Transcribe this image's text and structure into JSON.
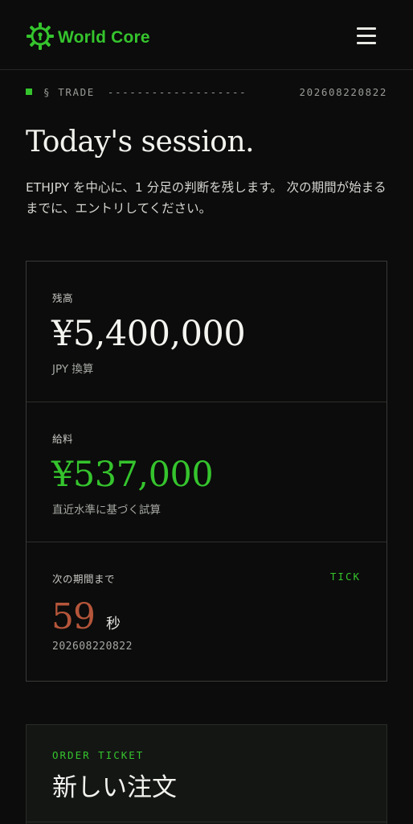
{
  "header": {
    "brand_name": "World Core",
    "logo_icon": "gear-lock-icon",
    "menu_icon": "hamburger-menu-icon",
    "accent_color": "#35c42d"
  },
  "section": {
    "label": "§ TRADE",
    "dashes": "-------------------",
    "timestamp": "202608220822"
  },
  "hero": {
    "title": "Today's session.",
    "intro": "ETHJPY を中心に、1 分足の判断を残します。 次の期間が始まるまでに、エントリしてください。"
  },
  "stats": {
    "balance": {
      "label": "残高",
      "value": "¥5,400,000",
      "sub": "JPY 換算"
    },
    "salary": {
      "label": "給料",
      "value": "¥537,000",
      "sub": "直近水準に基づく試算"
    },
    "countdown": {
      "label": "次の期間まで",
      "tag": "TICK",
      "seconds": "59",
      "unit": "秒",
      "timestamp": "202608220822",
      "seconds_color": "#b5553a"
    }
  },
  "order_ticket": {
    "eyebrow": "ORDER TICKET",
    "title": "新しい注文"
  }
}
